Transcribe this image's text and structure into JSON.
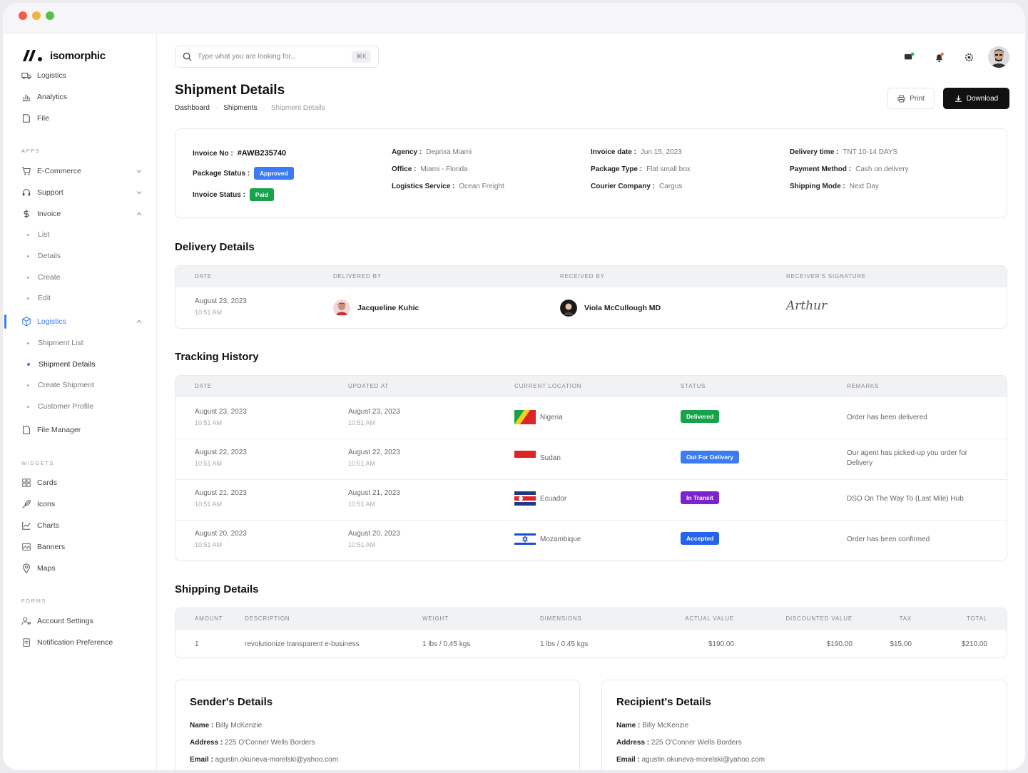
{
  "app": {
    "name": "isomorphic"
  },
  "colors": {
    "accent": "#3b7cf5",
    "approved": "#3b7cf5",
    "paid": "#16a34a",
    "delivered": "#16a34a",
    "out_for_delivery": "#3b7cf5",
    "in_transit": "#7e22ce",
    "accepted": "#2563eb"
  },
  "sidebar": {
    "items_top": [
      {
        "label": "Logistics",
        "icon": "truck-icon"
      },
      {
        "label": "Analytics",
        "icon": "chart-icon"
      },
      {
        "label": "File",
        "icon": "file-icon"
      }
    ],
    "apps_label": "APPS",
    "apps": [
      {
        "label": "E-Commerce",
        "icon": "cart-icon"
      },
      {
        "label": "Support",
        "icon": "headset-icon"
      },
      {
        "label": "Invoice",
        "icon": "dollar-icon"
      }
    ],
    "invoice_sub": [
      "List",
      "Details",
      "Create",
      "Edit"
    ],
    "logistics_label": "Logistics",
    "logistics_sub": [
      "Shipment List",
      "Shipment Details",
      "Create Shipment",
      "Customer Profile"
    ],
    "file_manager": "File Manager",
    "widgets_label": "WIDGETS",
    "widgets": [
      "Cards",
      "Icons",
      "Charts",
      "Banners",
      "Maps"
    ],
    "forms_label": "FORMS",
    "forms": [
      "Account Settings",
      "Notification Preference"
    ]
  },
  "search": {
    "placeholder": "Type what you are looking for...",
    "shortcut": "⌘K"
  },
  "page": {
    "title": "Shipment Details",
    "breadcrumb": [
      "Dashboard",
      "Shipments",
      "Shipment Details"
    ],
    "print_label": "Print",
    "download_label": "Download"
  },
  "invoice": {
    "invoice_no_label": "Invoice No :",
    "invoice_no": "#AWB235740",
    "package_status_label": "Package Status :",
    "package_status": "Approved",
    "invoice_status_label": "Invoice Status :",
    "invoice_status": "Paid",
    "agency_label": "Agency :",
    "agency": "Deprixa Miami",
    "office_label": "Office :",
    "office": "Miami - Florida",
    "logistics_service_label": "Logistics Service :",
    "logistics_service": "Ocean Freight",
    "invoice_date_label": "Invoice date :",
    "invoice_date": "Jun 15, 2023",
    "package_type_label": "Package Type :",
    "package_type": "Flat small box",
    "courier_label": "Courier Company :",
    "courier": "Cargus",
    "delivery_time_label": "Delivery time :",
    "delivery_time": "TNT 10-14 DAYS",
    "payment_method_label": "Payment Method :",
    "payment_method": "Cash on delivery",
    "shipping_mode_label": "Shipping Mode :",
    "shipping_mode": "Next Day"
  },
  "delivery": {
    "title": "Delivery Details",
    "headers": [
      "DATE",
      "DELIVERED BY",
      "RECEIVED BY",
      "RECEIVER'S SIGNATURE"
    ],
    "date": "August 23, 2023",
    "time": "10:51 AM",
    "delivered_by": "Jacqueline Kuhic",
    "received_by": "Viola McCullough MD",
    "signature": "Arthur"
  },
  "tracking": {
    "title": "Tracking History",
    "headers": [
      "DATE",
      "UPDATED AT",
      "CURRENT LOCATION",
      "STATUS",
      "REMARKS"
    ],
    "rows": [
      {
        "date": "August 23, 2023",
        "time": "10:51 AM",
        "updated": "August 23, 2023",
        "updated_time": "10:51 AM",
        "location": "Nigeria",
        "status": "Delivered",
        "remarks": "Order has been delivered"
      },
      {
        "date": "August 22, 2023",
        "time": "10:51 AM",
        "updated": "August 22, 2023",
        "updated_time": "10:51 AM",
        "location": "Sudan",
        "status": "Out For Delivery",
        "remarks": "Our agent has picked-up you order for Delivery"
      },
      {
        "date": "August 21, 2023",
        "time": "10:51 AM",
        "updated": "August 21, 2023",
        "updated_time": "10:51 AM",
        "location": "Ecuador",
        "status": "In Transit",
        "remarks": "DSO On The Way To (Last Mile) Hub"
      },
      {
        "date": "August 20, 2023",
        "time": "10:51 AM",
        "updated": "August 20, 2023",
        "updated_time": "10:51 AM",
        "location": "Mozambique",
        "status": "Accepted",
        "remarks": "Order has been confirmed"
      }
    ]
  },
  "shipping": {
    "title": "Shipping Details",
    "headers": [
      "AMOUNT",
      "DESCRIPTION",
      "WEIGHT",
      "DIMENSIONS",
      "ACTUAL VALUE",
      "DISCOUNTED VALUE",
      "TAX",
      "TOTAL"
    ],
    "row": [
      "1",
      "revolutionize transparent e-business",
      "1 lbs / 0.45 kgs",
      "1 lbs / 0.45 kgs",
      "$190.00",
      "$190.00",
      "$15.00",
      "$210.00"
    ]
  },
  "sender": {
    "title": "Sender's Details",
    "name_label": "Name :",
    "name": "Billy McKenzie",
    "address_label": "Address :",
    "address": "225 O'Conner Wells Borders",
    "email_label": "Email :",
    "email": "agustin.okuneva-morelski@yahoo.com"
  },
  "recipient": {
    "title": "Recipient's Details",
    "name_label": "Name :",
    "name": "Billy McKenzie",
    "address_label": "Address :",
    "address": "225 O'Conner Wells Borders",
    "email_label": "Email :",
    "email": "agustin.okuneva-morelski@yahoo.com"
  }
}
